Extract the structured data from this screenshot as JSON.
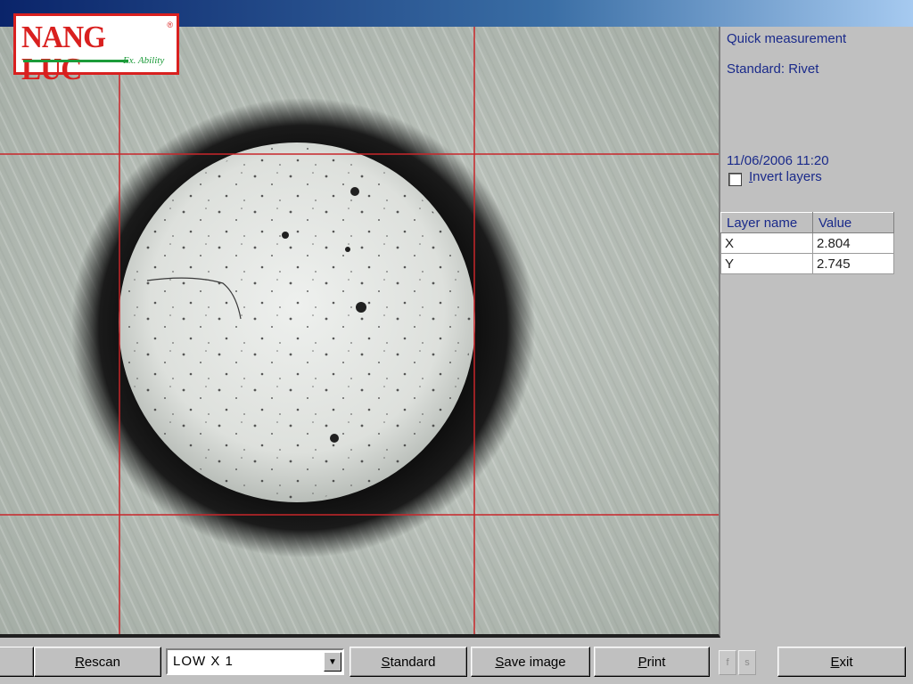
{
  "logo": {
    "main": "NANG LUC",
    "sub": "Ex. Ability",
    "reg": "®"
  },
  "panel": {
    "mode": "Quick measurement",
    "standard": "Standard: Rivet",
    "timestamp": "11/06/2006 11:20",
    "invert_label_u": "I",
    "invert_label_rest": "nvert layers",
    "invert_checked": false,
    "table": {
      "headers": [
        "Layer name",
        "Value"
      ],
      "rows": [
        [
          "X",
          "2.804"
        ],
        [
          "Y",
          "2.745"
        ]
      ]
    }
  },
  "toolbar": {
    "rescan_u": "R",
    "rescan_rest": "escan",
    "zoom_value": "LOW X 1",
    "standard_u": "S",
    "standard_rest": "tandard",
    "save_u": "S",
    "save_rest": "ave image",
    "print_u": "P",
    "print_rest": "rint",
    "mini1": "f",
    "mini2": "s",
    "exit_u": "E",
    "exit_rest": "xit"
  },
  "colors": {
    "crosshair": "#c8262a",
    "panel_text": "#1a2a8a",
    "logo_red": "#d9201f",
    "logo_green": "#1c9b3a"
  }
}
